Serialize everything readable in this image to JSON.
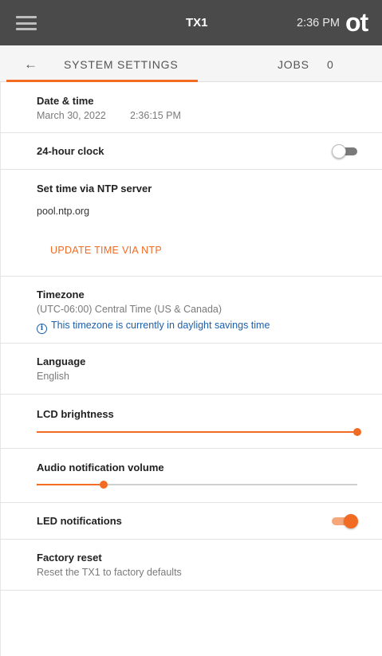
{
  "header": {
    "device_name": "TX1",
    "time": "2:36 PM",
    "logo_text": "ot",
    "menu_icon": "hamburger-menu-icon"
  },
  "tabs": {
    "back_icon": "arrow-left-icon",
    "system_settings_label": "SYSTEM SETTINGS",
    "jobs_label": "JOBS",
    "jobs_count": "0"
  },
  "settings": {
    "date_time": {
      "title": "Date & time",
      "date": "March 30, 2022",
      "time": "2:36:15 PM"
    },
    "clock24": {
      "title": "24-hour clock",
      "enabled": false
    },
    "ntp": {
      "title": "Set time via NTP server",
      "server": "pool.ntp.org",
      "button_label": "UPDATE TIME VIA NTP"
    },
    "timezone": {
      "title": "Timezone",
      "value": "(UTC-06:00) Central Time (US & Canada)",
      "info": "This timezone is currently in daylight savings time",
      "info_icon": "info-circle-icon"
    },
    "language": {
      "title": "Language",
      "value": "English"
    },
    "lcd_brightness": {
      "title": "LCD brightness",
      "level": 1.0
    },
    "audio_volume": {
      "title": "Audio notification volume",
      "level": 0.21
    },
    "led_notifications": {
      "title": "LED notifications",
      "enabled": true
    },
    "factory_reset": {
      "title": "Factory reset",
      "description": "Reset the TX1 to factory defaults"
    }
  },
  "colors": {
    "accent": "#f26b23",
    "header_bg": "#4a4a4a",
    "info_blue": "#1e5fa8"
  }
}
